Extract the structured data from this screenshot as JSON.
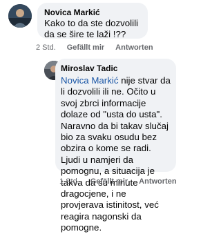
{
  "comments": [
    {
      "author": "Novica Markić",
      "text": "Kako to da ste dozvolili da se šire te laži !??",
      "time": "2 Std.",
      "like_label": "Gefällt mir",
      "reply_label": "Antworten"
    },
    {
      "author": "Miroslav Tadic",
      "mention": "Novica Markić",
      "text": " nije stvar da li dozvolili ili ne. Očito u svoj zbrci informacije dolaze od \"usta do usta\". Naravno da bi takav slučaj bio za svaku osudu bez obzira o kome se radi. Ljudi u namjeri da pomognu, a situacija je takva da su minute dragocjene, i ne provjerava istinitost, već reagira nagonski da pomogne.",
      "time": "1 Std.",
      "like_label": "Gefällt mir",
      "reply_label": "Antworten"
    }
  ]
}
